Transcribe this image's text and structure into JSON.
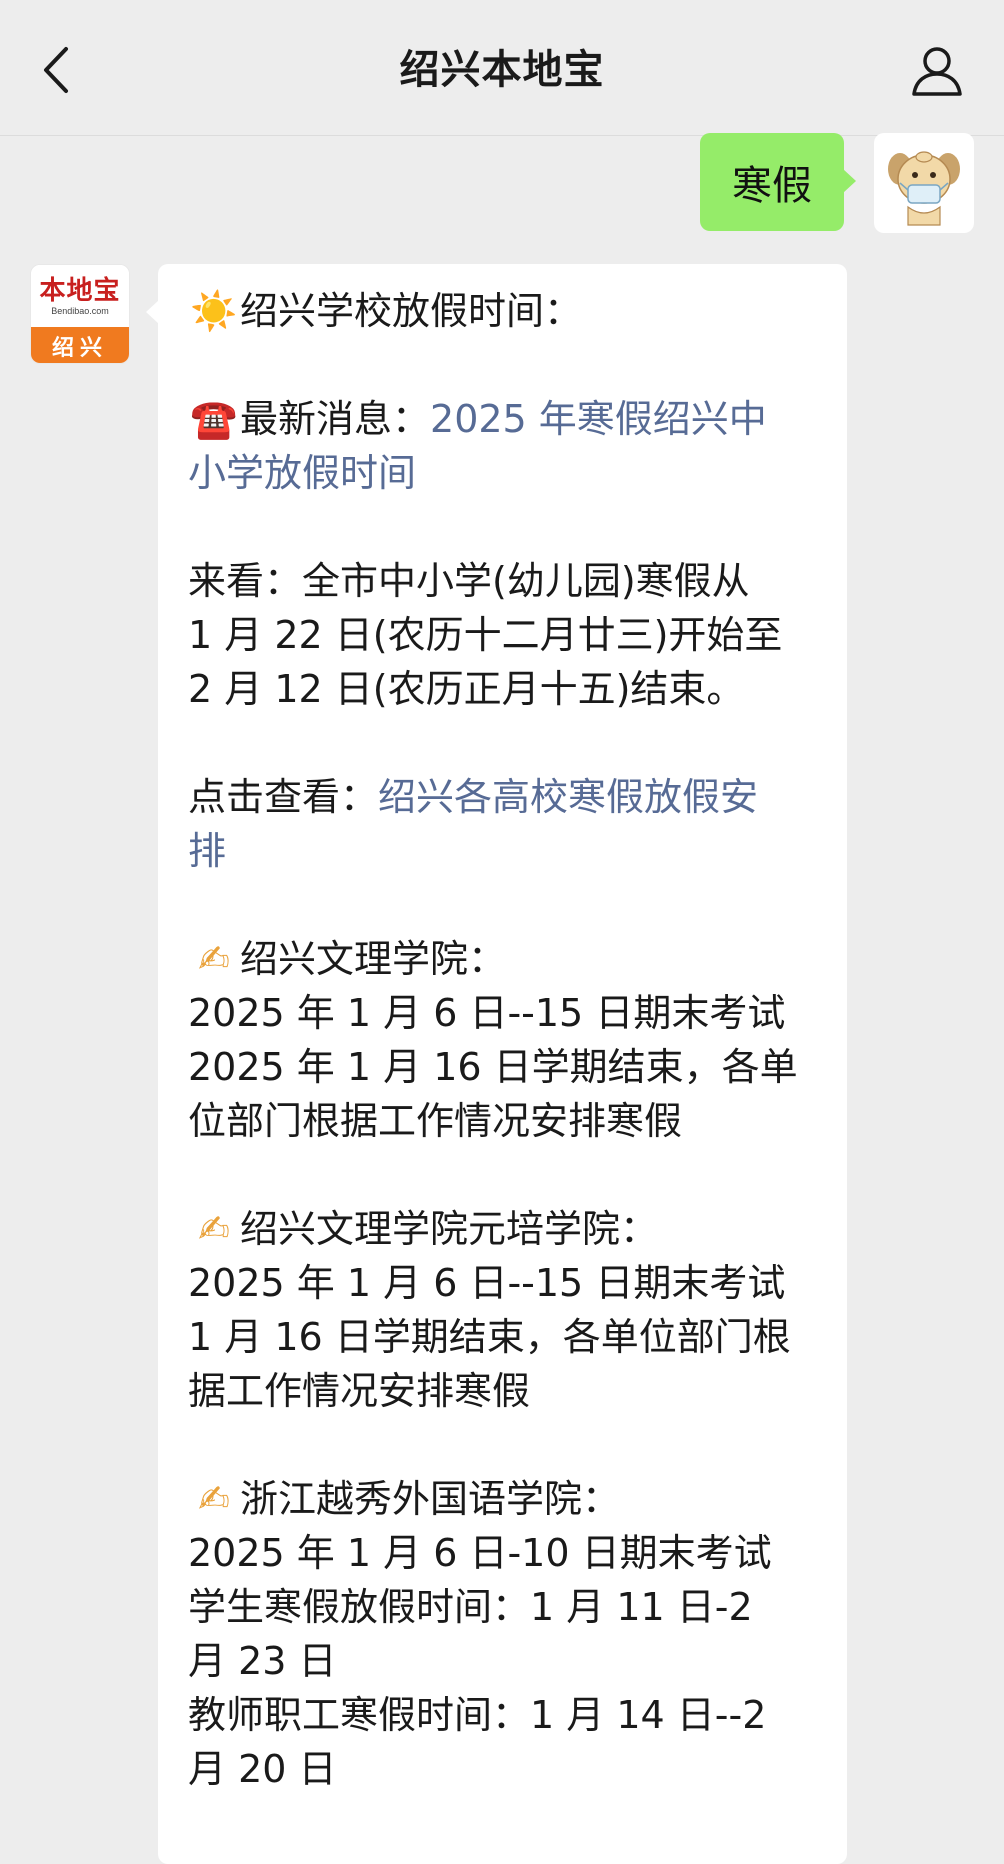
{
  "header": {
    "title": "绍兴本地宝"
  },
  "outgoing": {
    "text": "寒假"
  },
  "bot_avatar": {
    "name": "本地宝",
    "url": "Bendibao.com",
    "city": "绍兴"
  },
  "message": {
    "heading": "绍兴学校放假时间：",
    "latest_label": "最新消息：",
    "latest_link_line1": "2025 年寒假绍兴中",
    "latest_link_line2": "小学放假时间",
    "lookat_line1": "来看：全市中小学(幼儿园)寒假从",
    "lookat_line2": "1 月 22 日(农历十二月廿三)开始至",
    "lookat_line3": "2 月 12 日(农历正月十五)结束。",
    "click_label": "点击查看：",
    "click_link_line1": "绍兴各高校寒假放假安",
    "click_link_line2": "排",
    "school1_name": "绍兴文理学院：",
    "school1_line1": "2025 年 1 月 6 日--15 日期末考试",
    "school1_line2": "2025 年 1 月 16 日学期结束，各单",
    "school1_line3": "位部门根据工作情况安排寒假",
    "school2_name": "绍兴文理学院元培学院：",
    "school2_line1": "2025 年 1 月 6 日--15 日期末考试",
    "school2_line2": "1 月 16 日学期结束，各单位部门根",
    "school2_line3": "据工作情况安排寒假",
    "school3_name": "浙江越秀外国语学院：",
    "school3_line1": "2025 年 1 月 6 日-10 日期末考试",
    "school3_line2": "学生寒假放假时间：1 月 11 日-2",
    "school3_line3": "月 23 日",
    "school3_line4": "教师职工寒假时间：1 月 14 日--2",
    "school3_line5": "月 20 日"
  },
  "emojis": {
    "sun": "☀️",
    "phone": "☎️",
    "pen": "✍"
  }
}
